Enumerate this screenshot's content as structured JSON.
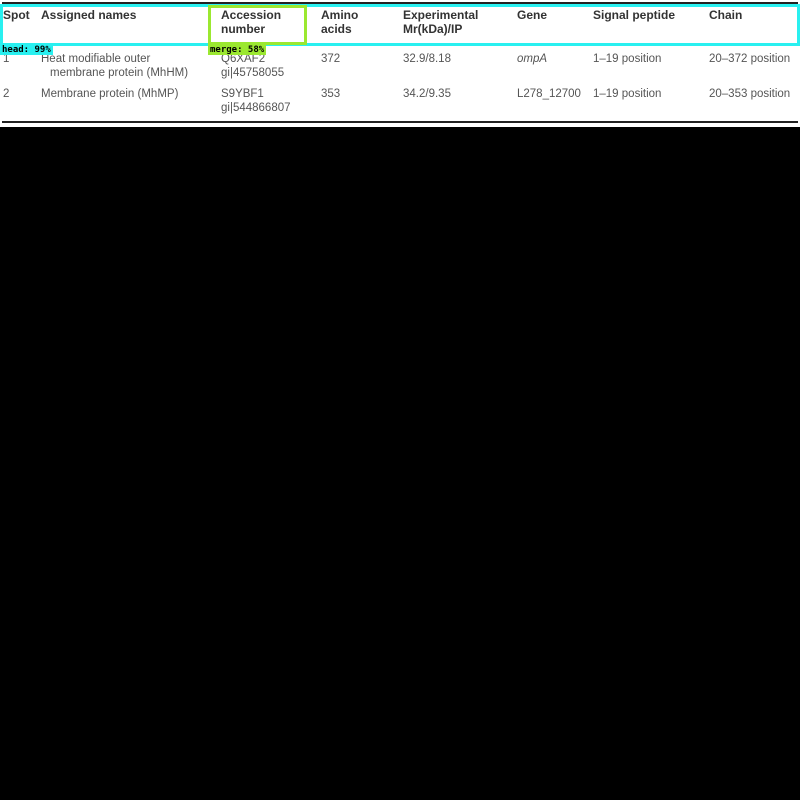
{
  "table": {
    "headers": {
      "spot": "Spot",
      "names": "Assigned names",
      "accession_1": "Accession",
      "accession_2": "number",
      "amino_1": "Amino",
      "amino_2": "acids",
      "exp_1": "Experimental",
      "exp_2": "Mr(kDa)/IP",
      "gene": "Gene",
      "signal": "Signal peptide",
      "chain": "Chain"
    },
    "rows": [
      {
        "spot": "1",
        "name_1": "Heat modifiable outer",
        "name_2": "membrane protein (MhHM)",
        "acc_1": "Q6XAF2",
        "acc_2": "gi|45758055",
        "amino": "372",
        "exp": "32.9/8.18",
        "gene": "ompA",
        "signal": "1–19 position",
        "chain": "20–372 position"
      },
      {
        "spot": "2",
        "name_1": "Membrane protein (MhMP)",
        "name_2": "",
        "acc_1": "S9YBF1",
        "acc_2": "gi|544866807",
        "amino": "353",
        "exp": "34.2/9.35",
        "gene": "L278_12700",
        "signal": "1–19 position",
        "chain": "20–353 position"
      }
    ]
  },
  "overlays": {
    "head_label": "head: 99%",
    "merge_label": "merge: 58%",
    "head_color": "#29f0f0",
    "merge_color": "#9be830"
  }
}
